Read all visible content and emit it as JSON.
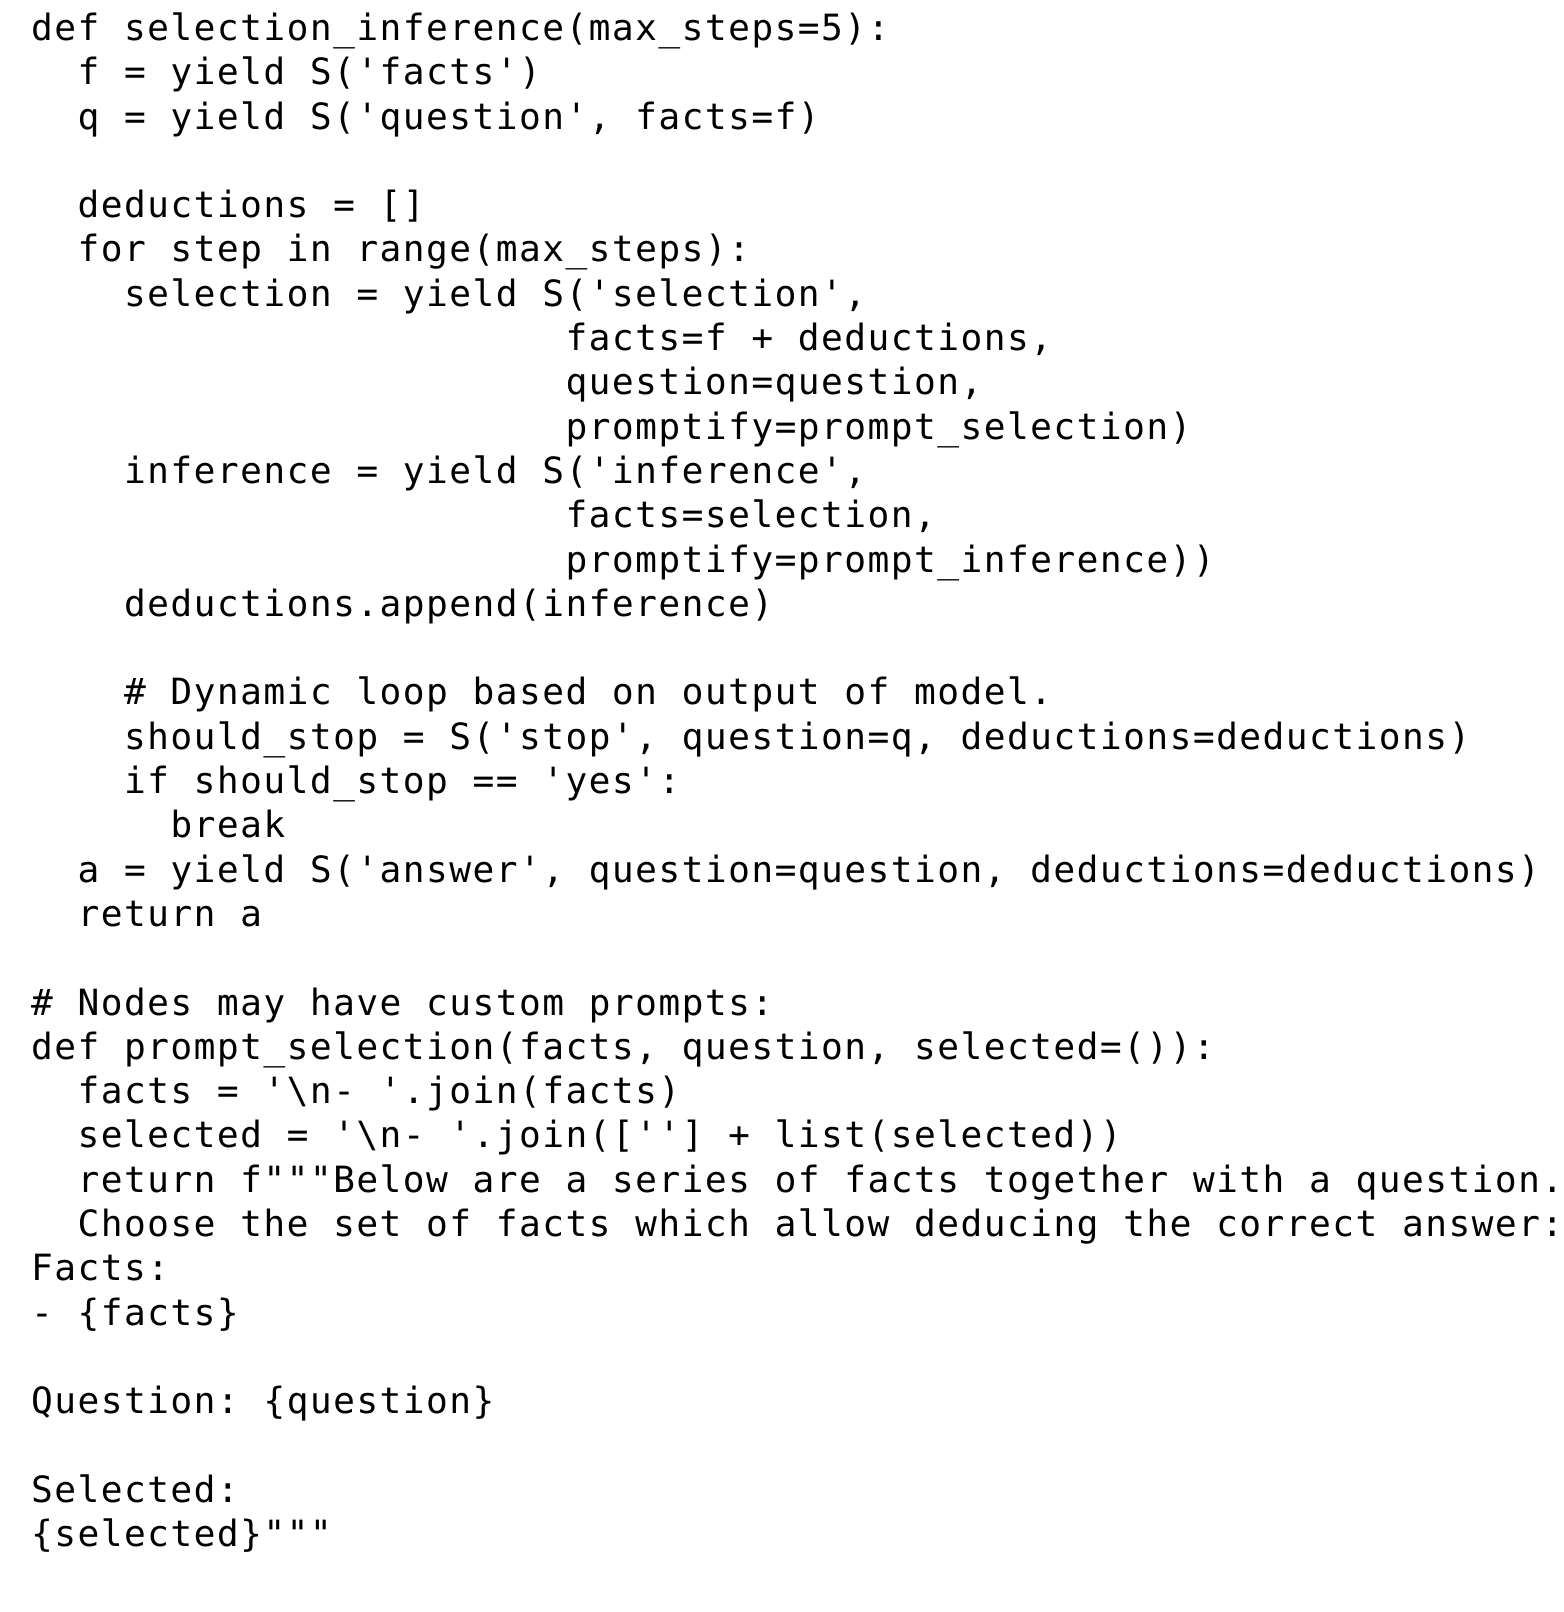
{
  "document": {
    "kind": "python-code-listing",
    "language": "Python",
    "background_color": "#ffffff",
    "text_color": "#000000",
    "code": "def selection_inference(max_steps=5):\n  f = yield S('facts')\n  q = yield S('question', facts=f)\n\n  deductions = []\n  for step in range(max_steps):\n    selection = yield S('selection',\n                       facts=f + deductions,\n                       question=question,\n                       promptify=prompt_selection)\n    inference = yield S('inference',\n                       facts=selection,\n                       promptify=prompt_inference))\n    deductions.append(inference)\n\n    # Dynamic loop based on output of model.\n    should_stop = S('stop', question=q, deductions=deductions)\n    if should_stop == 'yes':\n      break\n  a = yield S('answer', question=question, deductions=deductions)\n  return a\n\n# Nodes may have custom prompts:\ndef prompt_selection(facts, question, selected=()):\n  facts = '\\n- '.join(facts)\n  selected = '\\n- '.join([''] + list(selected))\n  return f\"\"\"Below are a series of facts together with a question.\n  Choose the set of facts which allow deducing the correct answer:\nFacts:\n- {facts}\n\nQuestion: {question}\n\nSelected:\n{selected}\"\"\"",
    "lines": [
      "def selection_inference(max_steps=5):",
      "  f = yield S('facts')",
      "  q = yield S('question', facts=f)",
      "",
      "  deductions = []",
      "  for step in range(max_steps):",
      "    selection = yield S('selection',",
      "                       facts=f + deductions,",
      "                       question=question,",
      "                       promptify=prompt_selection)",
      "    inference = yield S('inference',",
      "                       facts=selection,",
      "                       promptify=prompt_inference))",
      "    deductions.append(inference)",
      "",
      "    # Dynamic loop based on output of model.",
      "    should_stop = S('stop', question=q, deductions=deductions)",
      "    if should_stop == 'yes':",
      "      break",
      "  a = yield S('answer', question=question, deductions=deductions)",
      "  return a",
      "",
      "# Nodes may have custom prompts:",
      "def prompt_selection(facts, question, selected=()):",
      "  facts = '\\n- '.join(facts)",
      "  selected = '\\n- '.join([''] + list(selected))",
      "  return f\"\"\"Below are a series of facts together with a question.",
      "  Choose the set of facts which allow deducing the correct answer:",
      "Facts:",
      "- {facts}",
      "",
      "Question: {question}",
      "",
      "Selected:",
      "{selected}\"\"\""
    ]
  }
}
